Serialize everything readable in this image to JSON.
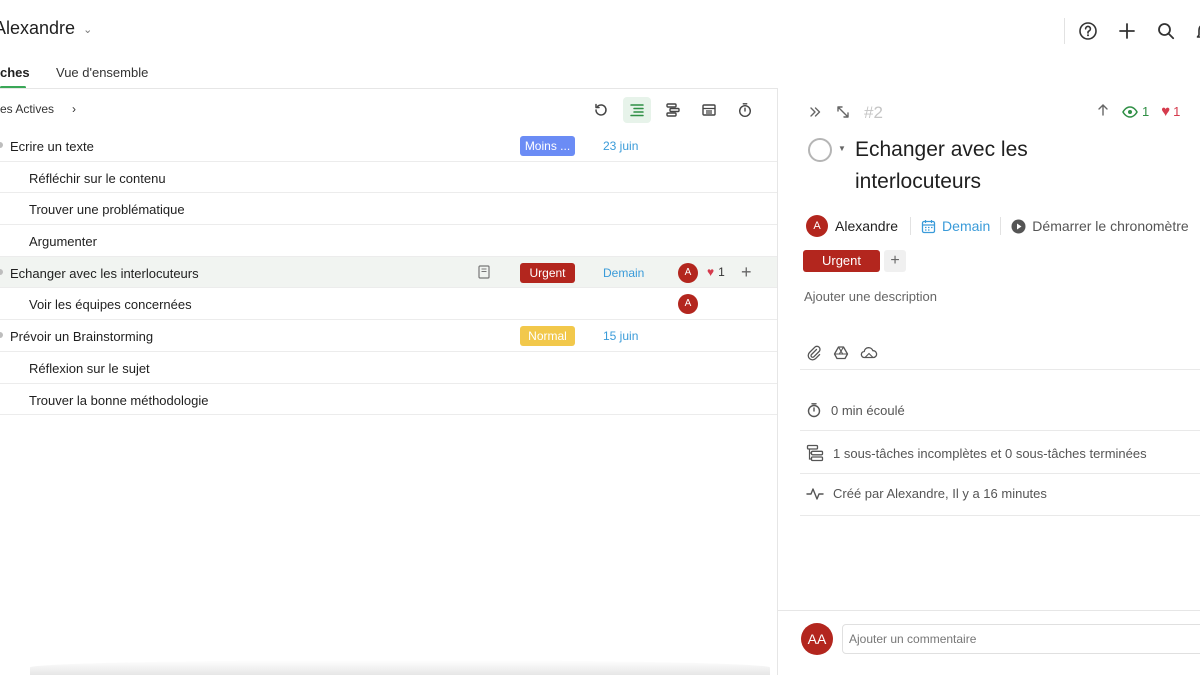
{
  "header": {
    "user_name": "Alexandre",
    "icons": [
      "help-icon",
      "plus-icon",
      "search-icon",
      "bell-icon"
    ]
  },
  "tabs": [
    {
      "label": "ches",
      "active": true
    },
    {
      "label": "Vue d'ensemble",
      "active": false
    }
  ],
  "list_toolbar": {
    "filter_label": "es Actives",
    "chevron": "›",
    "icons": [
      "refresh-icon",
      "list-view-icon",
      "subtasks-view-icon",
      "table-view-icon",
      "timer-icon"
    ]
  },
  "tasks": [
    {
      "name": "Ecrire un texte",
      "level": "parent",
      "priority": "Moins ...",
      "priority_color": "#6b8cf5",
      "due": "23 juin"
    },
    {
      "name": "Réfléchir sur le contenu",
      "level": "child"
    },
    {
      "name": "Trouver une problématique",
      "level": "child"
    },
    {
      "name": "Argumenter",
      "level": "child"
    },
    {
      "name": "Echanger avec les interlocuteurs",
      "level": "parent",
      "priority": "Urgent",
      "priority_color": "#b3261e",
      "due": "Demain",
      "assignee": "A",
      "likes": "1",
      "selected": true
    },
    {
      "name": "Voir les équipes concernées",
      "level": "child",
      "assignee": "A"
    },
    {
      "name": "Prévoir un Brainstorming",
      "level": "parent",
      "priority": "Normal",
      "priority_color": "#f2c84b",
      "due": "15 juin"
    },
    {
      "name": "Réflexion sur le sujet",
      "level": "child"
    },
    {
      "name": "Trouver la bonne méthodologie",
      "level": "child"
    }
  ],
  "detail": {
    "task_number": "#2",
    "watchers": "1",
    "likes": "1",
    "title": "Echanger avec les interlocuteurs",
    "assignee_initial": "A",
    "assignee_name": "Alexandre",
    "due": "Demain",
    "timer_label": "Démarrer le chronomètre",
    "tag": "Urgent",
    "tag_add": "+",
    "description_placeholder": "Ajouter une description",
    "elapsed": "0 min écoulé",
    "subtasks_summary": "1 sous-tâches incomplètes et 0 sous-tâches terminées",
    "activity": "Créé par Alexandre, Il y a 16 minutes",
    "comment_avatar": "AA",
    "comment_placeholder": "Ajouter un commentaire"
  },
  "colors": {
    "accent_green": "#3aa757",
    "urgent_red": "#b3261e",
    "link_blue": "#3a9bd9",
    "normal_yellow": "#f2c84b",
    "low_blue": "#6b8cf5"
  }
}
